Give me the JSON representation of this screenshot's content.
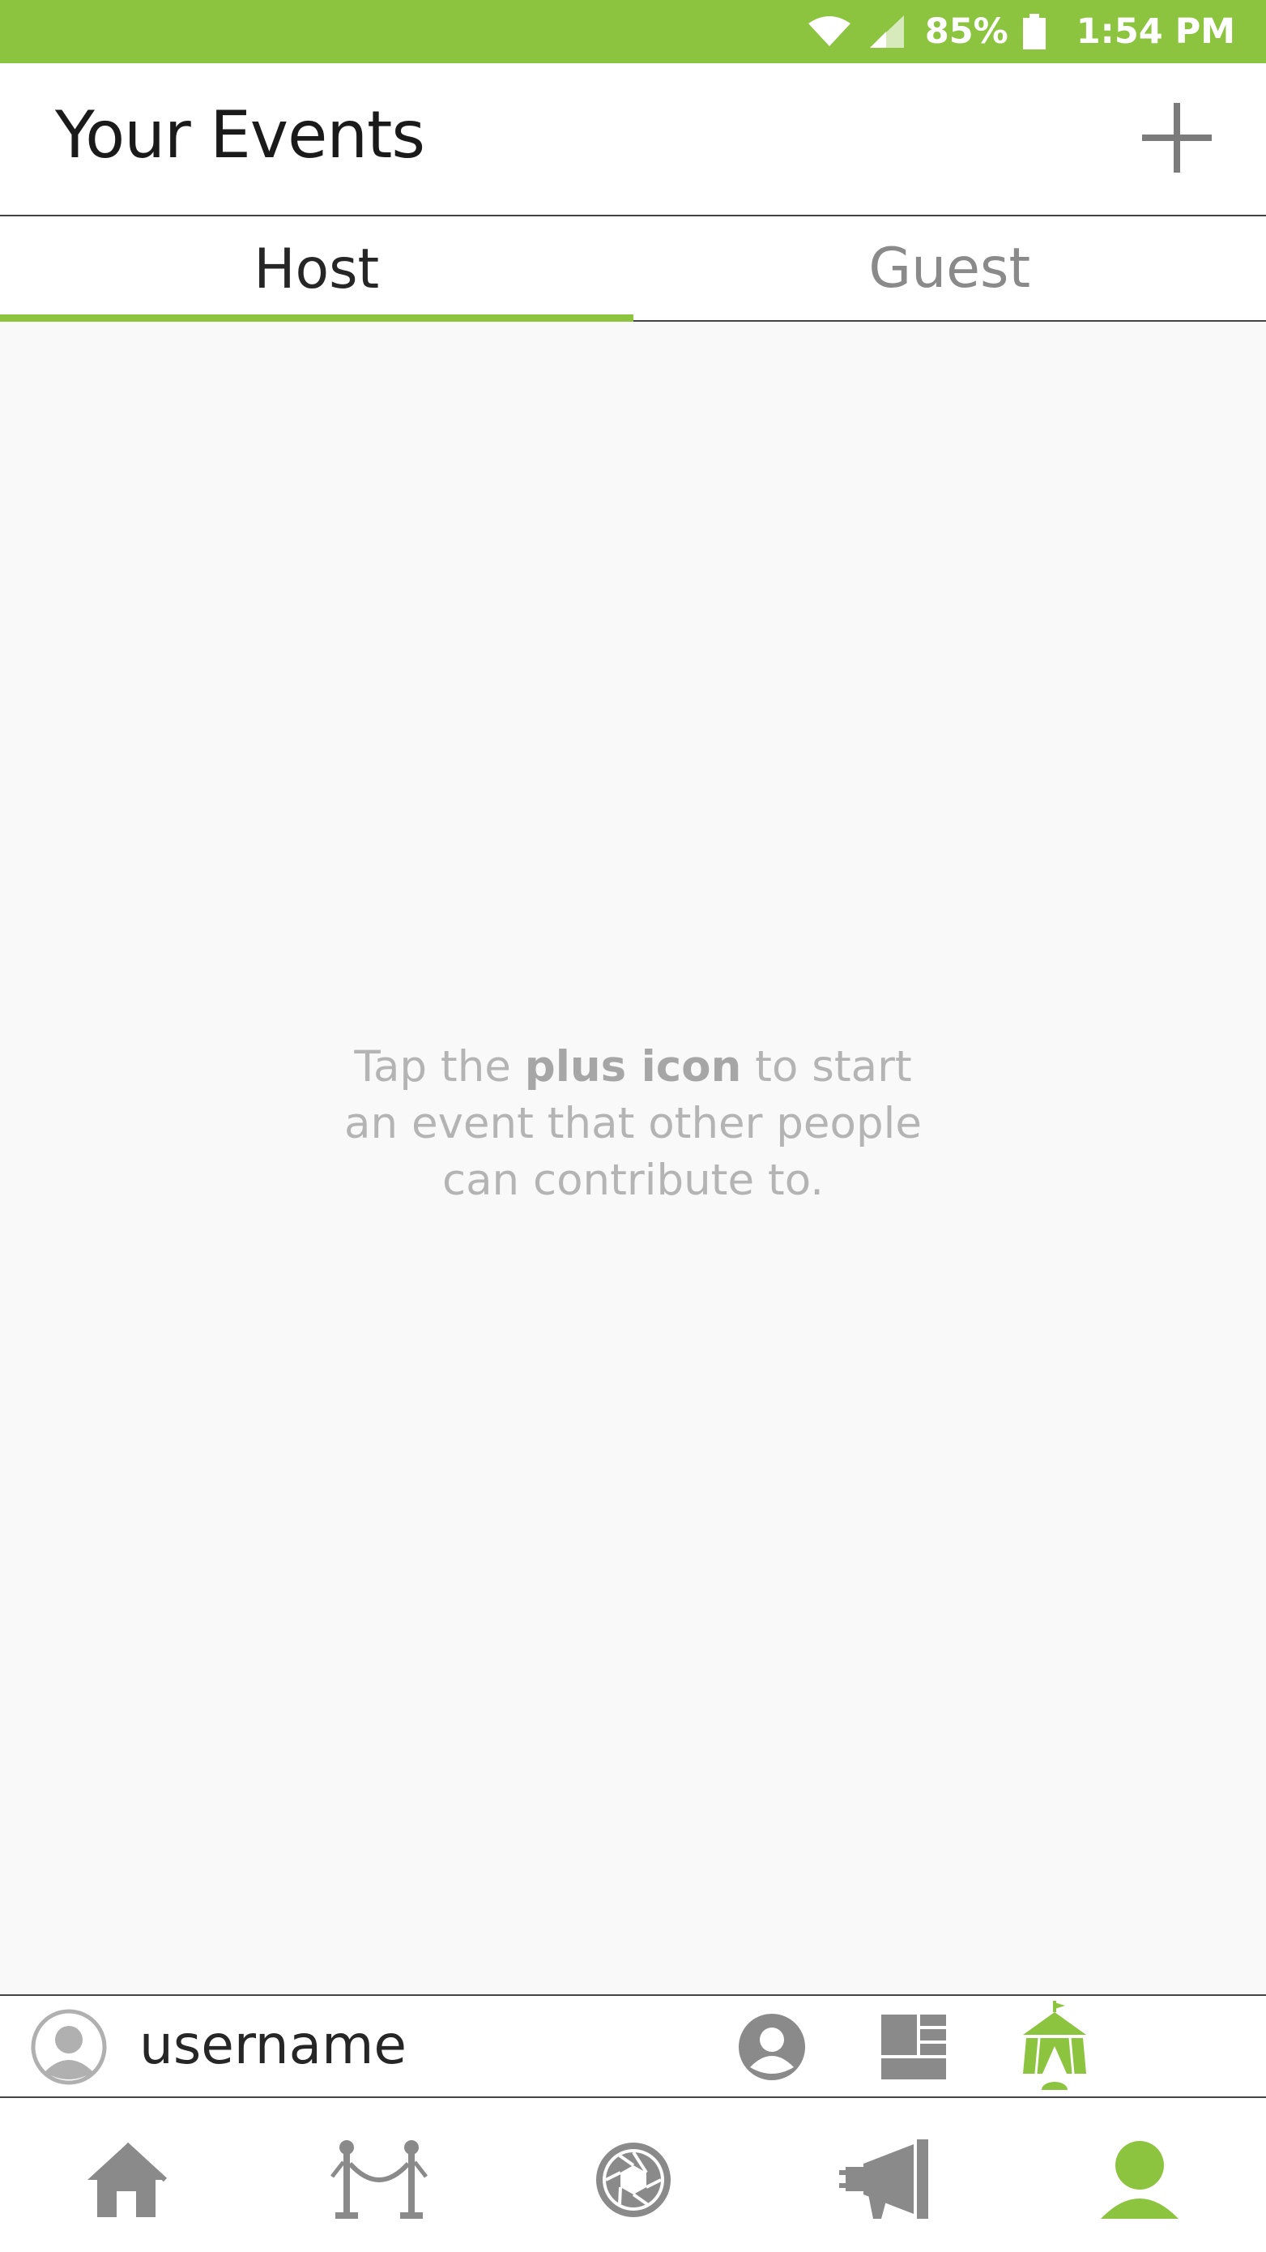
{
  "status_bar": {
    "battery_pct": "85%",
    "time": "1:54 PM",
    "icons": [
      "wifi-icon",
      "signal-icon",
      "battery-icon"
    ]
  },
  "header": {
    "title": "Your Events",
    "add_icon": "plus-icon"
  },
  "tabs": [
    {
      "label": "Host",
      "active": true
    },
    {
      "label": "Guest",
      "active": false
    }
  ],
  "empty_state": {
    "prefix": "Tap the ",
    "emphasis": "plus icon",
    "suffix_line1": " to start",
    "line2": "an event that other people",
    "line3": "can contribute to."
  },
  "profile_bar": {
    "username": "username",
    "icons": [
      "profile-icon",
      "grid-layout-icon",
      "tent-icon"
    ]
  },
  "bottom_nav": {
    "items": [
      "home-icon",
      "velvet-rope-icon",
      "camera-shutter-icon",
      "megaphone-icon",
      "person-icon"
    ],
    "active": "person-icon"
  },
  "colors": {
    "accent": "#8cc43f",
    "icon_gray": "#8a8a8a",
    "text_muted": "#b4b4b4"
  }
}
